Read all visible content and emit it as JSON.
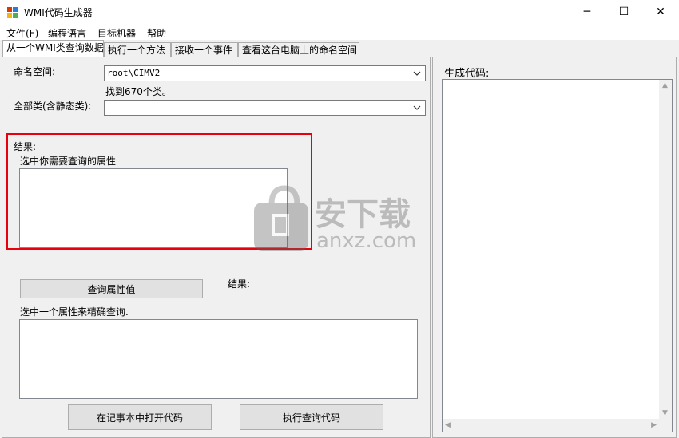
{
  "window": {
    "title": "WMI代码生成器",
    "minimize_glyph": "─",
    "maximize_glyph": "☐",
    "close_glyph": "✕"
  },
  "menu": {
    "items": [
      {
        "label": "文件(F)"
      },
      {
        "label": "编程语言"
      },
      {
        "label": "目标机器"
      },
      {
        "label": "帮助"
      }
    ]
  },
  "tabs": [
    {
      "label": "从一个WMI类查询数据",
      "active": true
    },
    {
      "label": "执行一个方法",
      "active": false
    },
    {
      "label": "接收一个事件",
      "active": false
    },
    {
      "label": "查看这台电脑上的命名空间",
      "active": false
    }
  ],
  "query_tab": {
    "namespace_label": "命名空间:",
    "namespace_value": "root\\CIMV2",
    "found_text": "找到670个类。",
    "class_label": "全部类(含静态类):",
    "class_value": "",
    "results_label": "结果:",
    "select_props_label": "选中你需要查询的属性",
    "query_button": "查询属性值",
    "results_label_2": "结果:",
    "refine_label": "选中一个属性来精确查询.",
    "open_notepad_button": "在记事本中打开代码",
    "execute_button": "执行查询代码"
  },
  "code_panel": {
    "label": "生成代码:",
    "content": ""
  },
  "watermark": {
    "text_cn": "安下载",
    "text_en": "anxz.com"
  },
  "colors": {
    "highlight_border": "#e8000b",
    "window_bg": "#f0f0f0"
  }
}
